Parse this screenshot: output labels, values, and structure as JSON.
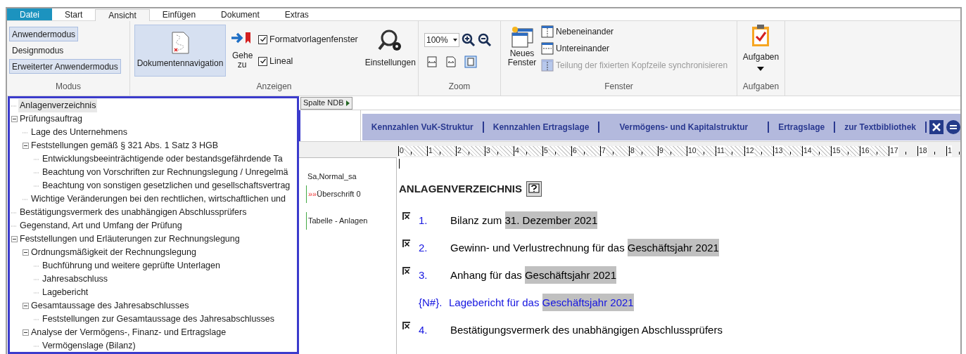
{
  "tabs": [
    {
      "label": "Datei",
      "kind": "file",
      "selected": false
    },
    {
      "label": "Start",
      "selected": false
    },
    {
      "label": "Ansicht",
      "selected": true
    },
    {
      "label": "Einfügen",
      "selected": false
    },
    {
      "label": "Dokument",
      "selected": false
    },
    {
      "label": "Extras",
      "selected": false
    }
  ],
  "ribbon": {
    "modus": {
      "title": "Modus",
      "items": [
        {
          "label": "Anwendermodus",
          "selected": true
        },
        {
          "label": "Designmodus",
          "selected": false
        },
        {
          "label": "Erweiterter Anwendermodus",
          "selected": true
        }
      ]
    },
    "anzeigen": {
      "title": "Anzeigen",
      "navigation": {
        "label": "Dokumentennavigation",
        "selected": true
      },
      "goto": "Gehe zu",
      "checkboxes": [
        {
          "label": "Formatvorlagenfenster",
          "checked": true
        },
        {
          "label": "Lineal",
          "checked": true
        }
      ],
      "settings": "Einstellungen"
    },
    "zoom": {
      "title": "Zoom",
      "value": "100%"
    },
    "fenster": {
      "title": "Fenster",
      "new_window": "Neues Fenster",
      "items": [
        {
          "label": "Nebeneinander",
          "disabled": false
        },
        {
          "label": "Untereinander",
          "disabled": false
        },
        {
          "label": "Teilung der fixierten Kopfzeile synchronisieren",
          "disabled": true
        }
      ]
    },
    "aufgaben": {
      "title": "Aufgaben",
      "button": "Aufgaben"
    }
  },
  "tree": [
    {
      "label": "Anlagenverzeichnis",
      "selected": true
    },
    {
      "label": "Prüfungsauftrag",
      "selected": false,
      "expanded": true,
      "children": [
        {
          "label": "Lage des Unternehmens",
          "selected": false
        },
        {
          "label": "Feststellungen gemäß § 321 Abs. 1 Satz 3 HGB",
          "selected": false,
          "expanded": true,
          "children": [
            {
              "label": "Entwicklungsbeeinträchtigende oder bestandsgefährdende Ta",
              "selected": false
            },
            {
              "label": "Beachtung von Vorschriften zur Rechnungslegung / Unregelmä",
              "selected": false
            },
            {
              "label": "Beachtung von sonstigen gesetzlichen und gesellschaftsvertrag",
              "selected": false
            }
          ]
        },
        {
          "label": "Wichtige Veränderungen bei den rechtlichen, wirtschaftlichen und",
          "selected": false
        }
      ]
    },
    {
      "label": "Bestätigungsvermerk des unabhängigen Abschlussprüfers",
      "selected": false
    },
    {
      "label": "Gegenstand, Art und Umfang der Prüfung",
      "selected": false
    },
    {
      "label": "Feststellungen und Erläuterungen zur Rechnungslegung",
      "selected": false,
      "expanded": true,
      "children": [
        {
          "label": "Ordnungsmäßigkeit der Rechnungslegung",
          "selected": false,
          "expanded": true,
          "children": [
            {
              "label": "Buchführung und weitere geprüfte Unterlagen",
              "selected": false
            },
            {
              "label": "Jahresabschluss",
              "selected": false
            },
            {
              "label": "Lagebericht",
              "selected": false
            }
          ]
        },
        {
          "label": "Gesamtaussage des Jahresabschlusses",
          "selected": false,
          "expanded": true,
          "children": [
            {
              "label": "Feststellungen zur Gesamtaussage des Jahresabschlusses",
              "selected": false
            }
          ]
        },
        {
          "label": "Analyse der Vermögens-, Finanz- und Ertragslage",
          "selected": false,
          "expanded": true,
          "children": [
            {
              "label": "Vermögenslage (Bilanz)",
              "selected": false
            }
          ]
        }
      ]
    }
  ],
  "column_button": "Spalte NDB",
  "links": [
    "Kennzahlen VuK-Struktur",
    "Kennzahlen Ertragslage",
    "Vermögens- und Kapitalstruktur",
    "Ertragslage",
    "zur Textbibliothek"
  ],
  "ruler": [
    "0",
    "1",
    "2",
    "3",
    "4",
    "5",
    "6",
    "7",
    "8",
    "9",
    "10",
    "11",
    "12",
    "13",
    "14",
    "15",
    "16",
    "17",
    "18",
    "1"
  ],
  "styles": [
    {
      "label": "Sa,Normal_sa"
    },
    {
      "marker": "»»",
      "label": "Überschrift 0"
    },
    {
      "label": "Tabelle - Anlagen"
    }
  ],
  "heading": "ANLAGENVERZEICHNIS",
  "items": [
    {
      "kind": "entry",
      "checked": true,
      "number": "1.",
      "text": "Bilanz zum ",
      "field": "31. Dezember 2021"
    },
    {
      "kind": "entry",
      "checked": true,
      "number": "2.",
      "text": "Gewinn- und Verlustrechnung für das ",
      "field": "Geschäftsjahr 2021"
    },
    {
      "kind": "entry",
      "checked": true,
      "number": "3.",
      "text": "Anhang für das ",
      "field": "Geschäftsjahr 2021"
    },
    {
      "kind": "placeholder",
      "number": "{N#}.",
      "text": "Lagebericht für das ",
      "field": "Geschäftsjahr 2021"
    },
    {
      "kind": "entry",
      "checked": true,
      "number": "4.",
      "text": "Bestätigungsvermerk des unabhängigen Abschlussprüfers"
    }
  ]
}
